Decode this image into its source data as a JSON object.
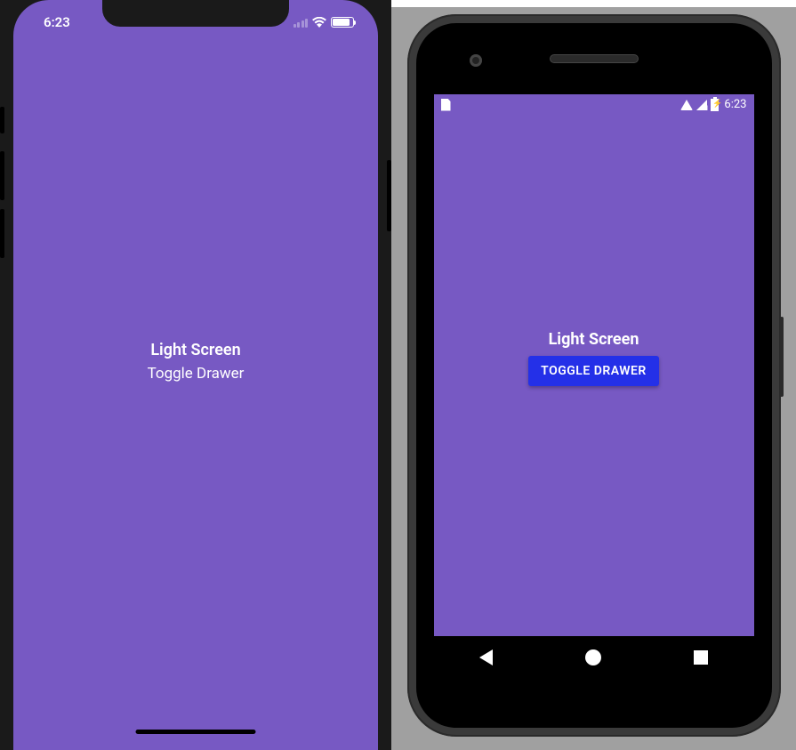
{
  "ios": {
    "status": {
      "time": "6:23"
    },
    "screen": {
      "title": "Light Screen",
      "toggle_label": "Toggle Drawer"
    }
  },
  "android": {
    "status": {
      "time": "6:23"
    },
    "screen": {
      "title": "Light Screen",
      "toggle_label": "TOGGLE DRAWER"
    }
  },
  "colors": {
    "app_background": "#7759c3",
    "android_button": "#2430e8"
  }
}
